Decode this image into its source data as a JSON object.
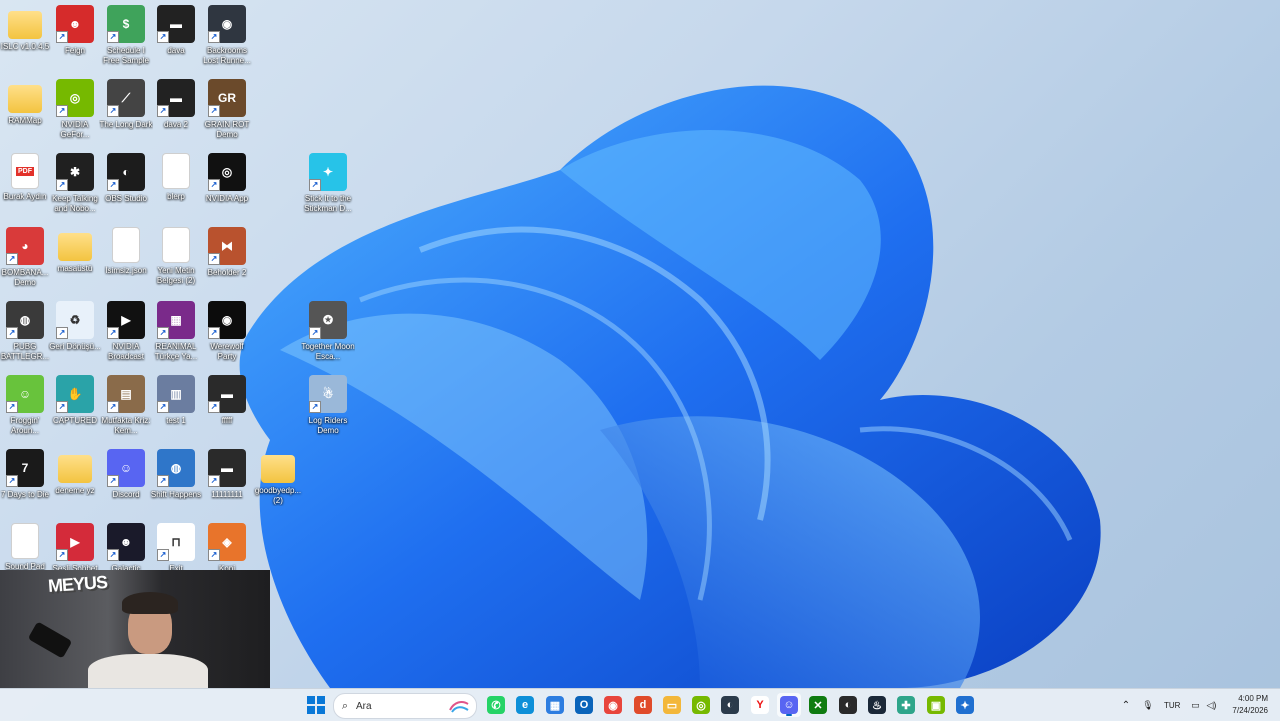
{
  "desktop": {
    "icons": [
      {
        "label": "ISLC v1.0.4.5",
        "kind": "folder"
      },
      {
        "label": "Feign",
        "kind": "app",
        "color": "#d62b2b",
        "glyph": "☻"
      },
      {
        "label": "Schedule I Free Sample",
        "kind": "app",
        "color": "#3fa35b",
        "glyph": "$"
      },
      {
        "label": "dava",
        "kind": "app",
        "color": "#222222",
        "glyph": "▬"
      },
      {
        "label": "Backrooms Lost Runne...",
        "kind": "app",
        "color": "#2f3640",
        "glyph": "◉"
      },
      {
        "label": "RAMMap",
        "kind": "folder"
      },
      {
        "label": "NVIDIA GeFor...",
        "kind": "app",
        "color": "#76b900",
        "glyph": "◎"
      },
      {
        "label": "The Long Dark",
        "kind": "app",
        "color": "#444444",
        "glyph": "⟋"
      },
      {
        "label": "dava 2",
        "kind": "app",
        "color": "#222222",
        "glyph": "▬"
      },
      {
        "label": "GRAIN ROT Demo",
        "kind": "app",
        "color": "#6b4a2b",
        "glyph": "GR"
      },
      {
        "label": "Burak Aydın",
        "kind": "pdf",
        "color": "#e2312a",
        "glyph": "PDF"
      },
      {
        "label": "Keep Talking and Nobo...",
        "kind": "app",
        "color": "#202020",
        "glyph": "✱"
      },
      {
        "label": "OBS Studio",
        "kind": "app",
        "color": "#1c1c1c",
        "glyph": "◐"
      },
      {
        "label": "blerp",
        "kind": "file"
      },
      {
        "label": "NVIDIA App",
        "kind": "app",
        "color": "#111111",
        "glyph": "◎"
      },
      {
        "label": "Stick It to the Stickman D...",
        "kind": "app",
        "color": "#27c3e8",
        "glyph": "✦"
      },
      {
        "label": "BOMBANA... Demo",
        "kind": "app",
        "color": "#d93a3a",
        "glyph": "◕"
      },
      {
        "label": "masaüstü",
        "kind": "folder"
      },
      {
        "label": "İsimsiz.json",
        "kind": "file"
      },
      {
        "label": "Yeni Metin Belgesi (2)",
        "kind": "file"
      },
      {
        "label": "Beholder 2",
        "kind": "app",
        "color": "#b9522e",
        "glyph": "⧓"
      },
      {
        "label": "PUBG BATTLEGR...",
        "kind": "app",
        "color": "#3a3a3a",
        "glyph": "◍"
      },
      {
        "label": "Geri Dönüşü...",
        "kind": "app",
        "color": "#e8f1fa",
        "glyph": "♻"
      },
      {
        "label": "NVIDIA Broadcast",
        "kind": "app",
        "color": "#111111",
        "glyph": "▶"
      },
      {
        "label": "REANIMAL Türkçe Ya...",
        "kind": "app",
        "color": "#7a2a8a",
        "glyph": "▦"
      },
      {
        "label": "Werewolf Party",
        "kind": "app",
        "color": "#0c0c0c",
        "glyph": "◉"
      },
      {
        "label": "Together Moon Esca...",
        "kind": "app",
        "color": "#555555",
        "glyph": "✪"
      },
      {
        "label": "Froggin' Aroun...",
        "kind": "app",
        "color": "#68c33c",
        "glyph": "☺"
      },
      {
        "label": "CAPTURED",
        "kind": "app",
        "color": "#2aa3a8",
        "glyph": "✋"
      },
      {
        "label": "Mutfakta Kriz: Kem...",
        "kind": "app",
        "color": "#8a6b4a",
        "glyph": "▤"
      },
      {
        "label": "test 1",
        "kind": "app",
        "color": "#6b7da0",
        "glyph": "▥"
      },
      {
        "label": "fffff",
        "kind": "app",
        "color": "#2a2a2a",
        "glyph": "▬"
      },
      {
        "label": "Log Riders Demo",
        "kind": "app",
        "color": "#9ab8d9",
        "glyph": "☃"
      },
      {
        "label": "7 Days to Die",
        "kind": "app",
        "color": "#1a1a1a",
        "glyph": "7"
      },
      {
        "label": "deneme yz",
        "kind": "folder"
      },
      {
        "label": "Discord",
        "kind": "app",
        "color": "#5865f2",
        "glyph": "☺"
      },
      {
        "label": "Shift Happens",
        "kind": "app",
        "color": "#2f76c9",
        "glyph": "◍"
      },
      {
        "label": "11111111",
        "kind": "app",
        "color": "#2a2a2a",
        "glyph": "▬"
      },
      {
        "label": "goodbyedp... (2)",
        "kind": "folder"
      },
      {
        "label": "Sound Pad",
        "kind": "file"
      },
      {
        "label": "Sesli Sohbet",
        "kind": "app",
        "color": "#d42b3a",
        "glyph": "▶"
      },
      {
        "label": "Galactic",
        "kind": "app",
        "color": "#1a1a2a",
        "glyph": "☻"
      },
      {
        "label": "Exit",
        "kind": "app",
        "color": "#ffffff",
        "glyph": "⊓"
      },
      {
        "label": "Kopi",
        "kind": "app",
        "color": "#e8742b",
        "glyph": "◈"
      }
    ]
  },
  "webcam": {
    "sign_text": "MEYUS"
  },
  "taskbar": {
    "search_label": "Ara",
    "apps": [
      {
        "name": "whatsapp",
        "color": "#25d366",
        "glyph": "✆"
      },
      {
        "name": "edge",
        "color": "#0d8fd8",
        "glyph": "e"
      },
      {
        "name": "microsoft-store",
        "color": "#2d7de0",
        "glyph": "▦"
      },
      {
        "name": "outlook",
        "color": "#0a64ba",
        "glyph": "O"
      },
      {
        "name": "chrome",
        "color": "#e8453c",
        "glyph": "◉"
      },
      {
        "name": "dts",
        "color": "#e04b2b",
        "glyph": "d"
      },
      {
        "name": "file-explorer",
        "color": "#f3b73a",
        "glyph": "▭"
      },
      {
        "name": "nvidia",
        "color": "#76b900",
        "glyph": "◎"
      },
      {
        "name": "obs",
        "color": "#2b3b4b",
        "glyph": "◐"
      },
      {
        "name": "yandex",
        "color": "#ffffff",
        "glyph": "Y"
      },
      {
        "name": "discord",
        "color": "#5865f2",
        "glyph": "☺"
      },
      {
        "name": "xbox",
        "color": "#107c10",
        "glyph": "✕"
      },
      {
        "name": "obs-studio",
        "color": "#2a2a2a",
        "glyph": "◐"
      },
      {
        "name": "steam",
        "color": "#1b2838",
        "glyph": "♨"
      },
      {
        "name": "app-green",
        "color": "#2ea58a",
        "glyph": "✚"
      },
      {
        "name": "nvidia-app",
        "color": "#76b900",
        "glyph": "▣"
      },
      {
        "name": "gear-app",
        "color": "#1f6fd0",
        "glyph": "✦"
      }
    ],
    "language": "TUR",
    "time": "4:00 PM",
    "date": "7/24/2026"
  }
}
